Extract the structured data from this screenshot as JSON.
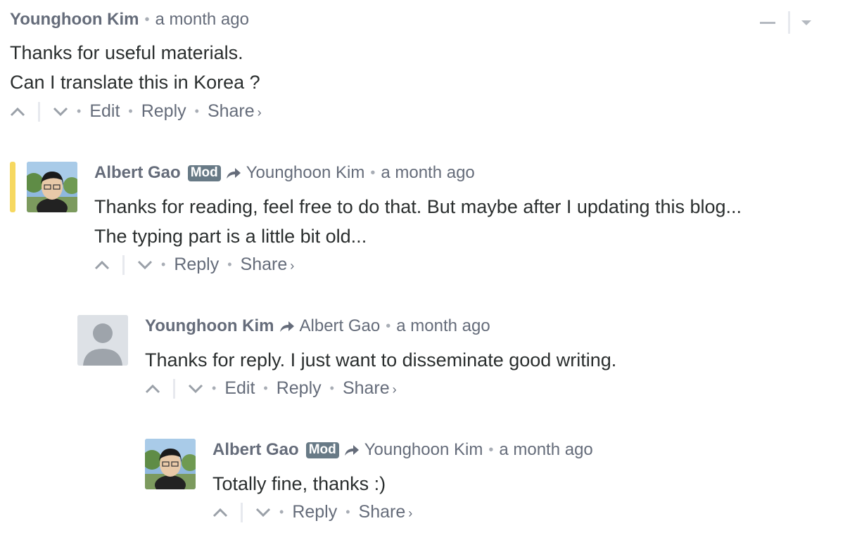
{
  "comments": [
    {
      "author": "Younghoon Kim",
      "time": "a month ago",
      "lines": [
        "Thanks for useful materials.",
        "Can I translate this in Korea ?"
      ],
      "actions": {
        "edit": "Edit",
        "reply": "Reply",
        "share": "Share"
      }
    },
    {
      "author": "Albert Gao",
      "badge": "Mod",
      "reply_to": "Younghoon Kim",
      "time": "a month ago",
      "lines": [
        "Thanks for reading, feel free to do that. But maybe after I updating this blog...",
        "The typing part is a little bit old..."
      ],
      "actions": {
        "reply": "Reply",
        "share": "Share"
      }
    },
    {
      "author": "Younghoon Kim",
      "reply_to": "Albert Gao",
      "time": "a month ago",
      "lines": [
        "Thanks for reply. I just want to disseminate good writing."
      ],
      "actions": {
        "edit": "Edit",
        "reply": "Reply",
        "share": "Share"
      }
    },
    {
      "author": "Albert Gao",
      "badge": "Mod",
      "reply_to": "Younghoon Kim",
      "time": "a month ago",
      "lines": [
        "Totally fine, thanks :)"
      ],
      "actions": {
        "reply": "Reply",
        "share": "Share"
      }
    }
  ],
  "separators": {
    "dot": "•",
    "share_caret": "›"
  },
  "colors": {
    "meta": "#656c7a",
    "text": "#2a2e2e",
    "mod_badge": "#687a86",
    "highlight": "#f6d860"
  }
}
